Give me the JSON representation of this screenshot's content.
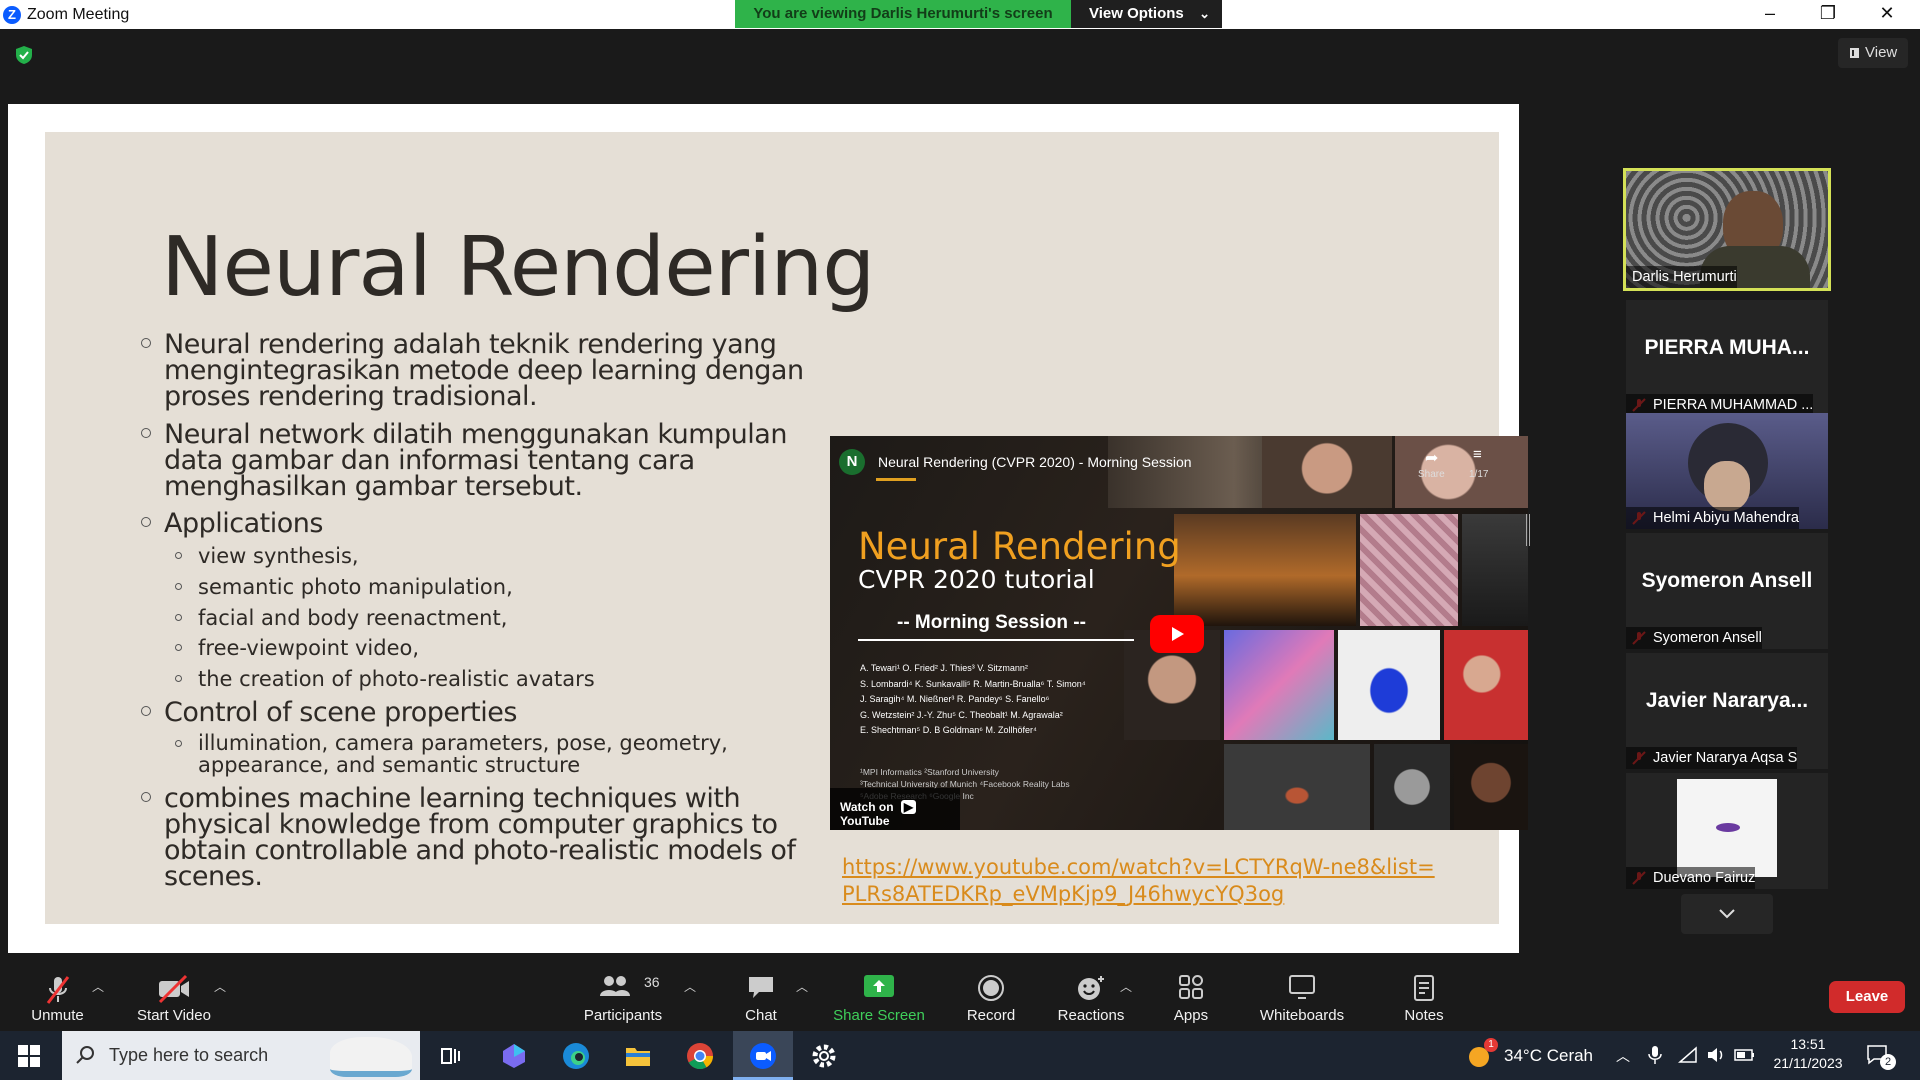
{
  "window": {
    "title": "Zoom Meeting",
    "banner": "You are viewing Darlis Herumurti's screen",
    "view_options": "View Options"
  },
  "view_button": "View",
  "slide": {
    "title": "Neural Rendering",
    "bullets": [
      {
        "lines": [
          "Neural rendering adalah teknik rendering yang",
          "mengintegrasikan metode deep learning dengan",
          "proses rendering tradisional."
        ]
      },
      {
        "lines": [
          "Neural network dilatih menggunakan kumpulan",
          "data gambar dan informasi tentang cara",
          "menghasilkan gambar tersebut."
        ]
      },
      {
        "lines": [
          "Applications"
        ]
      },
      {
        "lines": [
          "Control of scene properties"
        ]
      },
      {
        "lines": [
          "combines machine learning techniques with",
          "physical knowledge from computer graphics to",
          "obtain controllable and photo-realistic models of",
          "scenes."
        ]
      }
    ],
    "applications": [
      "view synthesis,",
      "semantic photo manipulation,",
      "facial and body reenactment,",
      "free-viewpoint video,",
      "the creation of photo-realistic avatars"
    ],
    "control_sub": [
      "illumination, camera parameters, pose, geometry,",
      "appearance, and semantic structure"
    ],
    "link": "https://www.youtube.com/watch?v=LCTYRqW-ne8&list=PLRs8ATEDKRp_eVMpKjp9_J46hwycYQ3og",
    "video": {
      "channel_initial": "N",
      "title": "Neural Rendering (CVPR 2020) - Morning Session",
      "share": "Share",
      "counter": "1/17",
      "heading": "Neural Rendering",
      "subheading": "CVPR 2020 tutorial",
      "session": "-- Morning Session --",
      "authors": [
        "A. Tewari¹  O. Fried²  J. Thies³  V. Sitzmann²",
        "S. Lombardi⁴  K. Sunkavalli⁵  R. Martin-Brualla⁶  T. Simon⁴",
        "J. Saragih⁴  M. Nießner³  R. Pandey⁶  S. Fanello⁶",
        "G. Wetzstein²  J.-Y. Zhu⁵  C. Theobalt¹  M. Agrawala²",
        "E. Shechtman⁵  D. B Goldman⁶  M. Zollhöfer⁴"
      ],
      "affiliations": [
        "¹MPI Informatics   ²Stanford University",
        "³Technical University of Munich   ⁴Facebook Reality Labs",
        "⁵Adobe Research   ⁶Google Inc"
      ],
      "watch_on": "Watch on",
      "youtube": "YouTube"
    }
  },
  "participants_panel": [
    {
      "big": "",
      "name": "Darlis Herumurti",
      "muted": false
    },
    {
      "big": "PIERRA  MUHA...",
      "name": "PIERRA MUHAMMAD ...",
      "muted": true
    },
    {
      "big": "",
      "name": "Helmi Abiyu Mahendra",
      "muted": true
    },
    {
      "big": "Syomeron Ansell",
      "name": "Syomeron Ansell",
      "muted": true
    },
    {
      "big": "Javier  Nararya...",
      "name": "Javier Nararya Aqsa S",
      "muted": true
    },
    {
      "big": "",
      "name": "Duevano Fairuz",
      "muted": true
    }
  ],
  "toolbar": {
    "unmute": "Unmute",
    "start_video": "Start Video",
    "participants": "Participants",
    "participant_count": "36",
    "chat": "Chat",
    "share_screen": "Share Screen",
    "record": "Record",
    "reactions": "Reactions",
    "apps": "Apps",
    "whiteboards": "Whiteboards",
    "notes": "Notes",
    "leave": "Leave"
  },
  "taskbar": {
    "search": "Type here to search",
    "weather": "34°C  Cerah",
    "time": "13:51",
    "date": "21/11/2023",
    "notif_count": "2",
    "weather_badge": "1"
  },
  "colors": {
    "banner_green": "#2fb34a",
    "share_green": "#2fb34a",
    "leave_red": "#d12b2b",
    "link_orange": "#d98b1c",
    "slide_bg": "#e5dfd6",
    "active_speaker": "#d4e157"
  }
}
